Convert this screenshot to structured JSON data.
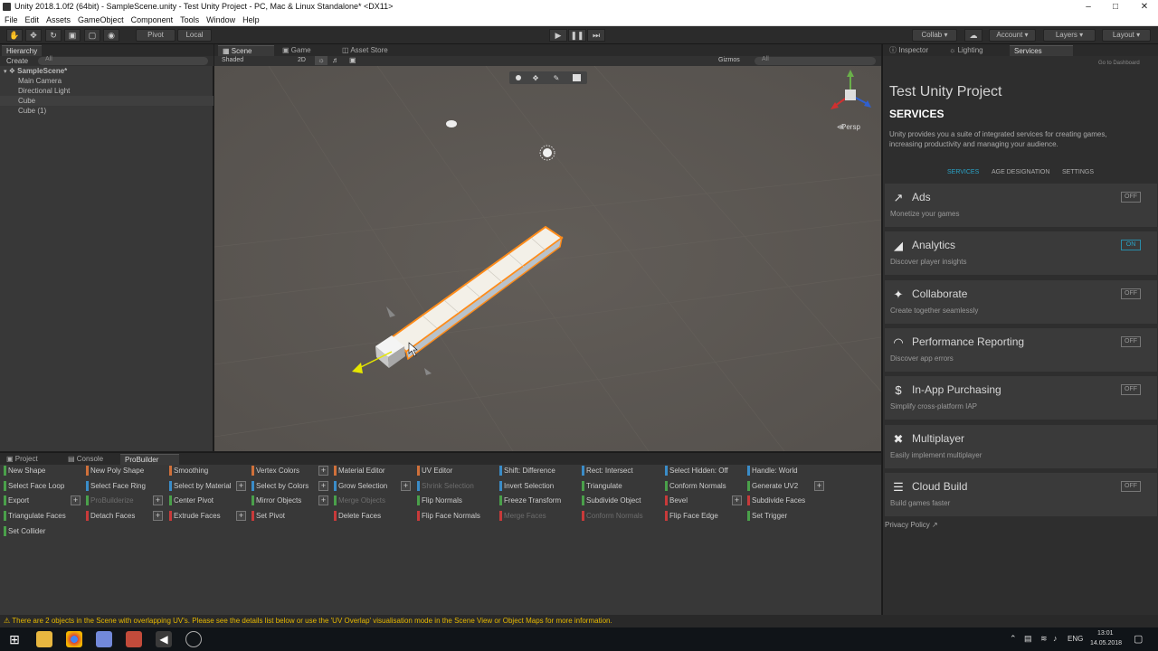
{
  "titlebar": {
    "title": "Unity 2018.1.0f2 (64bit) - SampleScene.unity - Test Unity Project - PC, Mac & Linux Standalone* <DX11>"
  },
  "menu": [
    "File",
    "Edit",
    "Assets",
    "GameObject",
    "Component",
    "Tools",
    "Window",
    "Help"
  ],
  "toolbar": {
    "pivot": "Pivot",
    "local": "Local",
    "collab": "Collab",
    "account": "Account",
    "layers": "Layers",
    "layout": "Layout"
  },
  "hierarchy": {
    "tab": "Hierarchy",
    "create": "Create",
    "search": "All",
    "scene": "SampleScene*",
    "items": [
      "Main Camera",
      "Directional Light",
      "Cube",
      "Cube (1)"
    ]
  },
  "scene": {
    "tabs": [
      "Scene",
      "Game",
      "Asset Store"
    ],
    "shading": "Shaded",
    "mode2d": "2D",
    "gizmos": "Gizmos",
    "search": "All",
    "persp": "Persp"
  },
  "bottom": {
    "tabs": [
      "Project",
      "Console",
      "ProBuilder"
    ]
  },
  "probuilder": {
    "col1": [
      {
        "label": "New Shape",
        "color": "#4aa04a"
      },
      {
        "label": "Select Face Loop",
        "color": "#4aa04a"
      },
      {
        "label": "Export",
        "color": "#4aa04a",
        "plus": true
      },
      {
        "label": "Triangulate Faces",
        "color": "#4aa04a"
      },
      {
        "label": "Set Collider",
        "color": "#4aa04a"
      }
    ],
    "col2": [
      {
        "label": "New Poly Shape",
        "color": "#d0703a"
      },
      {
        "label": "Select Face Ring",
        "color": "#3a8cc8"
      },
      {
        "label": "ProBuilderize",
        "color": "#4aa04a",
        "disabled": true,
        "plus": true
      },
      {
        "label": "Detach Faces",
        "color": "#c83a3a",
        "plus": true
      }
    ],
    "col3": [
      {
        "label": "Smoothing",
        "color": "#d0703a"
      },
      {
        "label": "Select by Material",
        "color": "#3a8cc8",
        "plus": true
      },
      {
        "label": "Center Pivot",
        "color": "#4aa04a"
      },
      {
        "label": "Extrude Faces",
        "color": "#c83a3a",
        "plus": true
      }
    ],
    "col4": [
      {
        "label": "Vertex Colors",
        "color": "#d0703a",
        "plus": true
      },
      {
        "label": "Select by Colors",
        "color": "#3a8cc8",
        "plus": true
      },
      {
        "label": "Mirror Objects",
        "color": "#4aa04a",
        "plus": true
      },
      {
        "label": "Set Pivot",
        "color": "#c83a3a"
      }
    ],
    "col5": [
      {
        "label": "Material Editor",
        "color": "#d0703a"
      },
      {
        "label": "Grow Selection",
        "color": "#3a8cc8",
        "plus": true
      },
      {
        "label": "Merge Objects",
        "color": "#4aa04a",
        "disabled": true
      },
      {
        "label": "Delete Faces",
        "color": "#c83a3a"
      }
    ],
    "col6": [
      {
        "label": "UV Editor",
        "color": "#d0703a"
      },
      {
        "label": "Shrink Selection",
        "color": "#3a8cc8",
        "disabled": true
      },
      {
        "label": "Flip Normals",
        "color": "#4aa04a"
      },
      {
        "label": "Flip Face Normals",
        "color": "#c83a3a"
      }
    ],
    "col7": [
      {
        "label": "Shift: Difference",
        "color": "#3a8cc8"
      },
      {
        "label": "Invert Selection",
        "color": "#3a8cc8"
      },
      {
        "label": "Freeze Transform",
        "color": "#4aa04a"
      },
      {
        "label": "Merge Faces",
        "color": "#c83a3a",
        "disabled": true
      }
    ],
    "col8": [
      {
        "label": "Rect: Intersect",
        "color": "#3a8cc8"
      },
      {
        "label": "Triangulate",
        "color": "#4aa04a"
      },
      {
        "label": "Subdivide Object",
        "color": "#4aa04a"
      },
      {
        "label": "Conform Normals",
        "color": "#c83a3a",
        "disabled": true
      }
    ],
    "col9": [
      {
        "label": "Select Hidden: Off",
        "color": "#3a8cc8"
      },
      {
        "label": "Conform Normals",
        "color": "#4aa04a"
      },
      {
        "label": "Bevel",
        "color": "#c83a3a",
        "plus": true
      },
      {
        "label": "Flip Face Edge",
        "color": "#c83a3a"
      }
    ],
    "col10": [
      {
        "label": "Handle: World",
        "color": "#3a8cc8"
      },
      {
        "label": "Generate UV2",
        "color": "#4aa04a",
        "plus": true
      },
      {
        "label": "Subdivide Faces",
        "color": "#c83a3a"
      },
      {
        "label": "Set Trigger",
        "color": "#4aa04a"
      }
    ]
  },
  "panel": {
    "tabs": [
      "Inspector",
      "Lighting",
      "Services"
    ],
    "goto": "Go to Dashboard",
    "project": "Test Unity Project",
    "heading": "SERVICES",
    "intro": "Unity provides you a suite of integrated services for creating games, increasing productivity and managing your audience.",
    "subtabs": [
      "SERVICES",
      "AGE DESIGNATION",
      "SETTINGS"
    ],
    "privacy": "Privacy Policy"
  },
  "services": [
    {
      "name": "Ads",
      "desc": "Monetize your games",
      "state": "OFF",
      "icon": "ads-icon",
      "glyph": "↗"
    },
    {
      "name": "Analytics",
      "desc": "Discover player insights",
      "state": "ON",
      "icon": "analytics-icon",
      "glyph": "◢"
    },
    {
      "name": "Collaborate",
      "desc": "Create together seamlessly",
      "state": "OFF",
      "icon": "collaborate-icon",
      "glyph": "✦"
    },
    {
      "name": "Performance Reporting",
      "desc": "Discover app errors",
      "state": "OFF",
      "icon": "performance-icon",
      "glyph": "◠"
    },
    {
      "name": "In-App Purchasing",
      "desc": "Simplify cross-platform IAP",
      "state": "OFF",
      "icon": "dollar-icon",
      "glyph": "$"
    },
    {
      "name": "Multiplayer",
      "desc": "Easily implement multiplayer",
      "state": "",
      "icon": "multiplayer-icon",
      "glyph": "✖"
    },
    {
      "name": "Cloud Build",
      "desc": "Build games faster",
      "state": "OFF",
      "icon": "cloud-build-icon",
      "glyph": "☰"
    }
  ],
  "status": {
    "message": "There are 2 objects in the Scene with overlapping UV's. Please see the details list below or use the 'UV Overlap' visualisation mode in the Scene View or Object Maps for more information."
  },
  "taskbar": {
    "lang": "ENG",
    "time": "13:01",
    "date": "14.05.2018"
  }
}
